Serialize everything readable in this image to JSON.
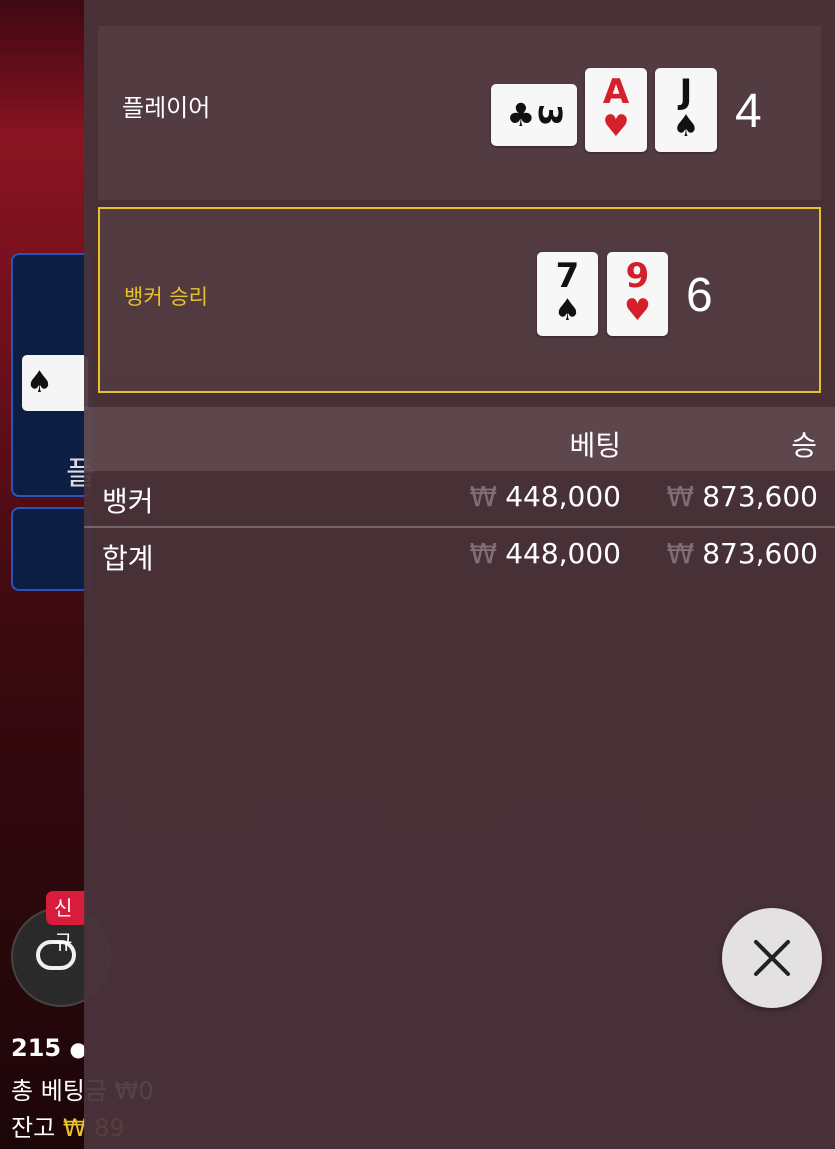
{
  "background": {
    "tile_label": "플",
    "tile_card_peek": "♠",
    "new_badge": "신규",
    "player_count": "215",
    "total_bet_label": "총 베팅금",
    "total_bet_value": "₩0",
    "balance_label": "잔고",
    "balance_currency": "₩",
    "balance_value": "89"
  },
  "result": {
    "player_label": "플레이어",
    "player_cards": [
      {
        "rank": "3",
        "suit": "♣",
        "color": "#111111"
      },
      {
        "rank": "A",
        "suit": "♥",
        "color": "#d4202a"
      },
      {
        "rank": "J",
        "suit": "♠",
        "color": "#111111"
      }
    ],
    "player_score": "4",
    "banker_label": "뱅커 승리",
    "banker_cards": [
      {
        "rank": "7",
        "suit": "♠",
        "color": "#111111"
      },
      {
        "rank": "9",
        "suit": "♥",
        "color": "#d4202a"
      }
    ],
    "banker_score": "6"
  },
  "bets": {
    "header_bet": "베팅",
    "header_win": "승",
    "currency": "₩",
    "rows": [
      {
        "label": "뱅커",
        "bet": "448,000",
        "win": "873,600"
      },
      {
        "label": "합계",
        "bet": "448,000",
        "win": "873,600"
      }
    ]
  },
  "colors": {
    "accent_gold": "#e9c22b",
    "badge_red": "#d81d3c",
    "tile_blue": "#2a55b8"
  },
  "icons": {
    "close": "close-icon",
    "lobby": "lobby-table-icon",
    "players": "person-icon"
  }
}
